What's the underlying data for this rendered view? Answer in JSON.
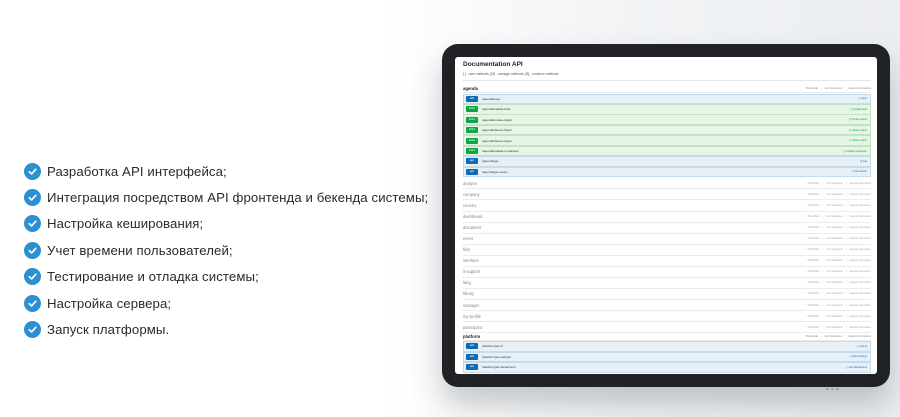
{
  "features": [
    "Разработка API интерфейса;",
    "Интеграция посредством API фронтенда и бекенда системы;",
    "Настройка кеширования;",
    "Учет времени пользователей;",
    "Тестирование и отладка системы;",
    "Настройка сервера;",
    "Запуск платформы."
  ],
  "doc": {
    "title": "Documentation API",
    "subtitle": "[ ] - user methods, [M] - manage methods, [B] - common methods",
    "links": {
      "show_hide": "Show/Hide",
      "list_ops": "List Operations",
      "expand_ops": "Expand Operations",
      "sep": "|"
    },
    "agenda": {
      "name": "agenda",
      "ops": [
        {
          "method": "GET",
          "path": "/agenda/view",
          "desc": "[ ] View",
          "kind": "get"
        },
        {
          "method": "POST",
          "path": "/agenda/update-field",
          "desc": "[ ] Update field",
          "kind": "post"
        },
        {
          "method": "POST",
          "path": "/agenda/create-object",
          "desc": "[ ] Create object",
          "kind": "post"
        },
        {
          "method": "POST",
          "path": "/agenda/delete-object",
          "desc": "[ ] Delete object",
          "kind": "post"
        },
        {
          "method": "POST",
          "path": "/agenda/delete-object",
          "desc": "[ ] Delete object",
          "kind": "post"
        },
        {
          "method": "POST",
          "path": "/agenda/update-moderator",
          "desc": "[ ] Update moderator",
          "kind": "post"
        },
        {
          "method": "GET",
          "path": "/agenda/get",
          "desc": "[ ] Get",
          "kind": "get"
        },
        {
          "method": "GET",
          "path": "/agenda/get-senior",
          "desc": "[ ] Get senior",
          "kind": "get"
        }
      ]
    },
    "resources": [
      "analyze",
      "company",
      "country",
      "dashboard",
      "document",
      "event",
      "files",
      "interface",
      "it-support",
      "lang",
      "library",
      "manager",
      "my-profile",
      "participant"
    ],
    "platform": {
      "name": "platform",
      "ops": [
        {
          "method": "GET",
          "path": "/platform/get-id",
          "desc": "[ ] Get id",
          "kind": "get"
        },
        {
          "method": "GET",
          "path": "/platform/get-settings",
          "desc": "[ ] Get settings",
          "kind": "get"
        },
        {
          "method": "GET",
          "path": "/platform/get-disclaimers",
          "desc": "[ ] Get disclaimers",
          "kind": "get"
        }
      ]
    }
  },
  "colors": {
    "accent": "#2b8fd0",
    "get": "#0f6ab4",
    "post": "#10a54a",
    "tablet": "#202226"
  }
}
